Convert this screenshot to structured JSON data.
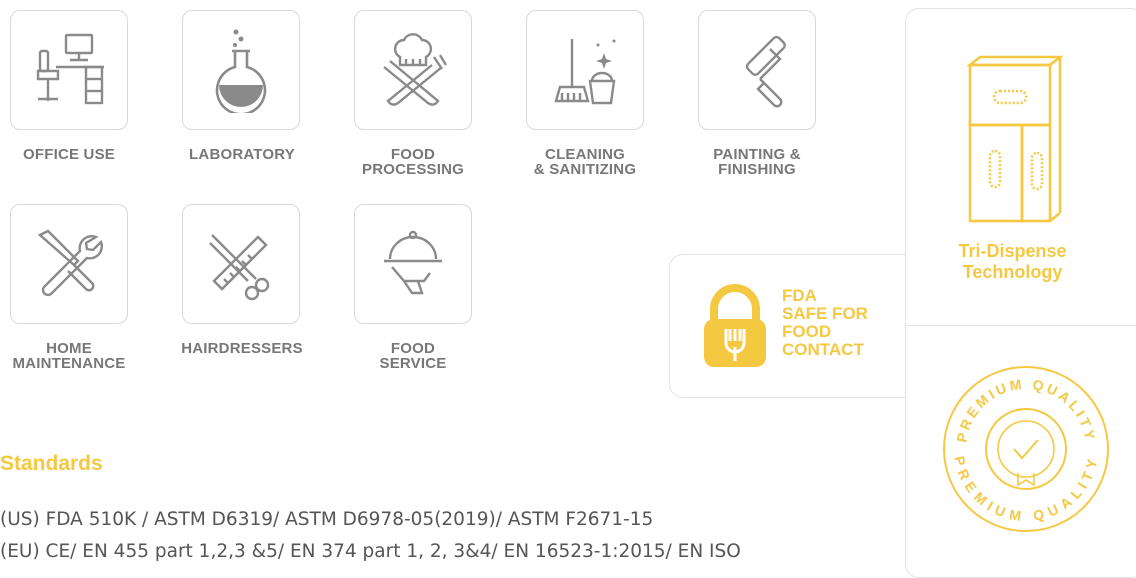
{
  "industries": [
    {
      "name": "office-use",
      "label": "OFFICE USE"
    },
    {
      "name": "laboratory",
      "label": "LABORATORY"
    },
    {
      "name": "food-processing",
      "label": "FOOD\nPROCESSING"
    },
    {
      "name": "cleaning-sanitizing",
      "label": "CLEANING\n& SANITIZING"
    },
    {
      "name": "painting-finishing",
      "label": "PAINTING &\nFINISHING"
    },
    {
      "name": "home-maintenance",
      "label": "HOME\nMAINTENANCE"
    },
    {
      "name": "hairdressers",
      "label": "HAIRDRESSERS"
    },
    {
      "name": "food-service",
      "label": "FOOD\nSERVICE"
    }
  ],
  "fda": {
    "line1": "FDA",
    "line2": "SAFE FOR",
    "line3": "FOOD",
    "line4": "CONTACT"
  },
  "tri_dispense": {
    "line1": "Tri-Dispense",
    "line2": "Technology"
  },
  "premium": {
    "text": "PREMIUM QUALITY"
  },
  "standards": {
    "title": "Standards",
    "lines": [
      "(US) FDA 510K / ASTM D6319/ ASTM D6978-05(2019)/ ASTM F2671-15",
      "(EU) CE/ EN 455 part 1,2,3 &5/ EN 374 part 1, 2, 3&4/ EN 16523-1:2015/ EN ISO"
    ]
  },
  "colors": {
    "accent": "#f5c842",
    "icon_gray": "#8a8a8a",
    "label_gray": "#777777"
  }
}
